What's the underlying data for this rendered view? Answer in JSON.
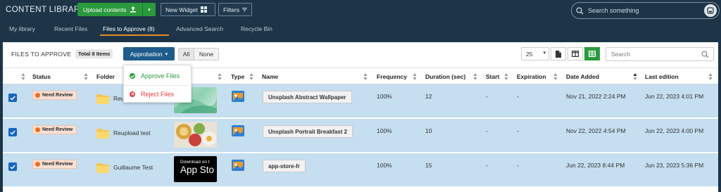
{
  "app": {
    "title": "CONTENT LIBRARY",
    "upload_label": "Upload contents",
    "new_widget_label": "New Widget",
    "filters_label": "Filters",
    "search_placeholder": "Search something"
  },
  "nav": {
    "tabs": [
      {
        "label": "My library"
      },
      {
        "label": "Recent Files"
      },
      {
        "label": "Files to Approve (8)"
      },
      {
        "label": "Advanced Search"
      },
      {
        "label": "Recycle Bin"
      }
    ],
    "active_index": 2
  },
  "toolbar": {
    "label": "FILES TO APPROVE",
    "count": "Total 8 Items",
    "approbation_label": "Approbation",
    "all_label": "All",
    "none_label": "None",
    "per_page": "25",
    "search_placeholder": "Search"
  },
  "dropdown": {
    "approve_label": "Approve Files",
    "reject_label": "Reject Files"
  },
  "table": {
    "headers": {
      "status": "Status",
      "folder": "Folder",
      "type": "Type",
      "name": "Name",
      "frequency": "Frequency",
      "duration": "Duration (sec)",
      "start": "Start",
      "expiration": "Expiration",
      "date_added": "Date Added",
      "last_edition": "Last edition"
    },
    "rows": [
      {
        "status": "Need Review",
        "folder": "Reupload test",
        "name": "Unsplash Abstract Wallpaper",
        "frequency": "100%",
        "duration": "12",
        "start": "-",
        "expiration": "-",
        "date_added": "Nov 21, 2022 2:24 PM",
        "last_edition": "Jun 22, 2023 4:01 PM",
        "thumb_text": ""
      },
      {
        "status": "Need Review",
        "folder": "Reupload test",
        "name": "Unsplash Portrait Breakfast 2",
        "frequency": "100%",
        "duration": "10",
        "start": "-",
        "expiration": "-",
        "date_added": "Nov 22, 2022 4:54 PM",
        "last_edition": "Jun 22, 2023 4:00 PM",
        "thumb_text": ""
      },
      {
        "status": "Need Review",
        "folder": "Guillaume Test",
        "name": "app-store-fr",
        "frequency": "100%",
        "duration": "15",
        "start": "-",
        "expiration": "-",
        "date_added": "Jun 22, 2023 8:44 PM",
        "last_edition": "Jun 23, 2023 5:36 PM",
        "thumb_text_small": "Download on t",
        "thumb_text_big": "App Sto"
      }
    ]
  },
  "colors": {
    "topbar": "#1e3548",
    "green": "#2a9a3d",
    "approb_blue": "#1f5c8c",
    "row_selected": "#c5def0",
    "tab_underline": "#e58d2a"
  },
  "icons": [
    "upload-icon",
    "grid-icon",
    "filter-icon",
    "search-icon",
    "user-icon",
    "file-icon",
    "columns-icon",
    "table-icon",
    "check-icon",
    "folder-icon",
    "image-icon",
    "sort-icon"
  ]
}
